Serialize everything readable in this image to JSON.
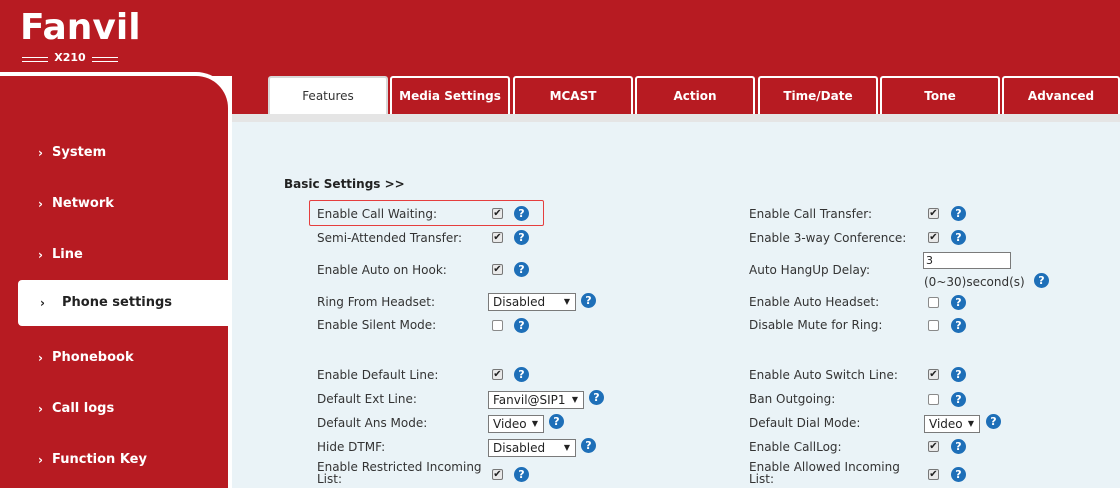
{
  "app": {
    "brand": "Fanvil",
    "model": "X210"
  },
  "sidebar": {
    "items": [
      {
        "label": "System"
      },
      {
        "label": "Network"
      },
      {
        "label": "Line"
      },
      {
        "label": "Phone settings"
      },
      {
        "label": "Phonebook"
      },
      {
        "label": "Call logs"
      },
      {
        "label": "Function Key"
      }
    ],
    "active": "Phone settings",
    "chevron": "›"
  },
  "tabs": [
    {
      "label": "Features"
    },
    {
      "label": "Media Settings"
    },
    {
      "label": "MCAST"
    },
    {
      "label": "Action"
    },
    {
      "label": "Time/Date"
    },
    {
      "label": "Tone"
    },
    {
      "label": "Advanced"
    }
  ],
  "active_tab": "Features",
  "basic_settings": {
    "title": "Basic Settings >>",
    "left": [
      {
        "label": "Enable Call Waiting:",
        "control": "checkbox",
        "checked": true
      },
      {
        "label": "Semi-Attended Transfer:",
        "control": "checkbox",
        "checked": true
      },
      {
        "label": "Enable Auto on Hook:",
        "control": "checkbox",
        "checked": true
      },
      {
        "label": "Ring From Headset:",
        "control": "select",
        "value": "Disabled"
      },
      {
        "label": "Enable Silent Mode:",
        "control": "checkbox",
        "checked": false
      },
      {
        "label": "Enable Default Line:",
        "control": "checkbox",
        "checked": true
      },
      {
        "label": "Default Ext Line:",
        "control": "select",
        "value": "Fanvil@SIP1"
      },
      {
        "label": "Default Ans Mode:",
        "control": "select",
        "value": "Video"
      },
      {
        "label": "Hide DTMF:",
        "control": "select",
        "value": "Disabled"
      },
      {
        "label": "Enable Restricted Incoming List:",
        "control": "checkbox",
        "checked": true
      }
    ],
    "right": [
      {
        "label": "Enable Call Transfer:",
        "control": "checkbox",
        "checked": true
      },
      {
        "label": "Enable 3-way Conference:",
        "control": "checkbox",
        "checked": true
      },
      {
        "label": "Auto HangUp Delay:",
        "control": "text",
        "value": "3",
        "unit": "(0~30)second(s)"
      },
      {
        "label": "Enable Auto Headset:",
        "control": "checkbox",
        "checked": false
      },
      {
        "label": "Disable Mute for Ring:",
        "control": "checkbox",
        "checked": false
      },
      {
        "label": "Enable Auto Switch Line:",
        "control": "checkbox",
        "checked": true
      },
      {
        "label": "Ban Outgoing:",
        "control": "checkbox",
        "checked": false
      },
      {
        "label": "Default Dial Mode:",
        "control": "select",
        "value": "Video"
      },
      {
        "label": "Enable CallLog:",
        "control": "checkbox",
        "checked": true
      },
      {
        "label": "Enable Allowed Incoming List:",
        "control": "checkbox",
        "checked": true
      }
    ]
  },
  "icons": {
    "help": "?",
    "check": "✔",
    "dropdown": "▼"
  },
  "colors": {
    "brand_red": "#b71b22",
    "content_bg": "#eaf3f7",
    "help_blue": "#1e6fb8",
    "highlight": "#e53e3e"
  }
}
